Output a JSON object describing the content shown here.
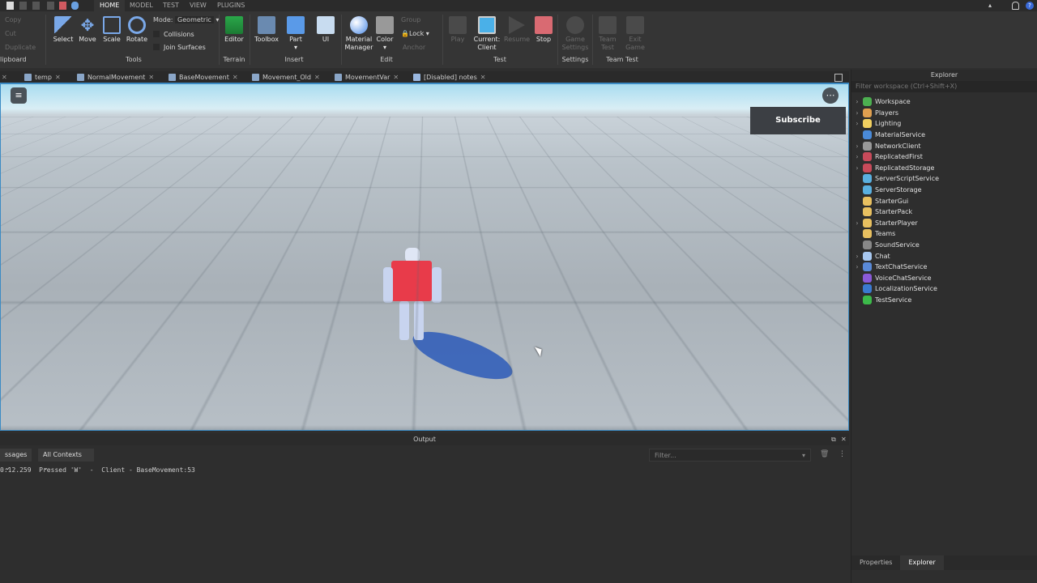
{
  "menu": {
    "tabs": [
      "HOME",
      "MODEL",
      "TEST",
      "VIEW",
      "PLUGINS"
    ],
    "active": "HOME"
  },
  "ribbon": {
    "clipboard": {
      "copy": "Copy",
      "cut": "Cut",
      "duplicate": "Duplicate",
      "group": "lipboard"
    },
    "tools": {
      "select": "Select",
      "move": "Move",
      "scale": "Scale",
      "rotate": "Rotate",
      "mode_label": "Mode:",
      "mode_value": "Geometric",
      "collisions": "Collisions",
      "join_surfaces": "Join Surfaces",
      "group": "Tools"
    },
    "terrain": {
      "editor": "Editor",
      "group": "Terrain"
    },
    "insert": {
      "toolbox": "Toolbox",
      "part": "Part",
      "ui": "UI",
      "group": "Insert"
    },
    "edit": {
      "material_manager": "Material Manager",
      "color": "Color",
      "group_btn": "Group",
      "lock": "Lock",
      "anchor": "Anchor",
      "group": "Edit"
    },
    "test": {
      "play": "Play",
      "current": "Current:",
      "client": "Client",
      "resume": "Resume",
      "stop": "Stop",
      "group": "Test"
    },
    "settings": {
      "game_settings": "Game Settings",
      "group": "Settings"
    },
    "team_test": {
      "team_test": "Team Test",
      "exit_game": "Exit Game",
      "group": "Team Test"
    }
  },
  "tabs": [
    "temp",
    "NormalMovement",
    "BaseMovement",
    "Movement_Old",
    "MovementVar",
    "[Disabled] notes"
  ],
  "viewport": {
    "subscribe": "Subscribe"
  },
  "output": {
    "title": "Output",
    "messages_filter": "ssages",
    "contexts_filter": "All Contexts",
    "filter_placeholder": "Filter...",
    "log": [
      {
        "time": "0:12.259",
        "text": "Pressed 'W'  -  Client - BaseMovement:53"
      }
    ]
  },
  "explorer": {
    "title": "Explorer",
    "filter_placeholder": "Filter workspace (Ctrl+Shift+X)",
    "items": [
      {
        "name": "Workspace",
        "expandable": true,
        "color": "#4caf50"
      },
      {
        "name": "Players",
        "expandable": true,
        "color": "#e0a050"
      },
      {
        "name": "Lighting",
        "expandable": true,
        "color": "#f2d060"
      },
      {
        "name": "MaterialService",
        "expandable": false,
        "color": "#4a8ad8"
      },
      {
        "name": "NetworkClient",
        "expandable": true,
        "color": "#999999"
      },
      {
        "name": "ReplicatedFirst",
        "expandable": true,
        "color": "#c84a5a"
      },
      {
        "name": "ReplicatedStorage",
        "expandable": true,
        "color": "#c84a5a"
      },
      {
        "name": "ServerScriptService",
        "expandable": false,
        "color": "#5ab0e0"
      },
      {
        "name": "ServerStorage",
        "expandable": false,
        "color": "#5ab0e0"
      },
      {
        "name": "StarterGui",
        "expandable": false,
        "color": "#e8c060"
      },
      {
        "name": "StarterPack",
        "expandable": false,
        "color": "#e8c060"
      },
      {
        "name": "StarterPlayer",
        "expandable": true,
        "color": "#e8c060"
      },
      {
        "name": "Teams",
        "expandable": false,
        "color": "#e8c060"
      },
      {
        "name": "SoundService",
        "expandable": false,
        "color": "#888888"
      },
      {
        "name": "Chat",
        "expandable": true,
        "color": "#a8c8f0"
      },
      {
        "name": "TextChatService",
        "expandable": true,
        "color": "#5a8ad8"
      },
      {
        "name": "VoiceChatService",
        "expandable": false,
        "color": "#8a5ad8"
      },
      {
        "name": "LocalizationService",
        "expandable": false,
        "color": "#3a7ad0"
      },
      {
        "name": "TestService",
        "expandable": false,
        "color": "#3cba4a"
      }
    ]
  },
  "bottom_tabs": {
    "properties": "Properties",
    "explorer": "Explorer"
  }
}
